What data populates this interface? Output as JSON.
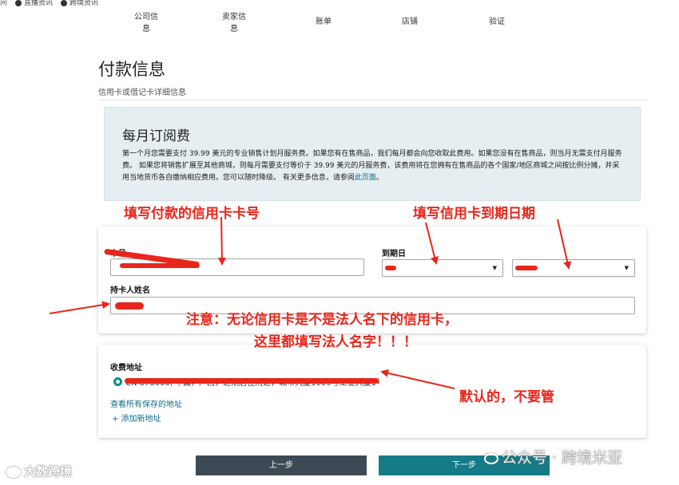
{
  "top_toolbar": {
    "items": [
      "问",
      "直播资讯",
      "跨境资讯"
    ]
  },
  "steps": [
    "公司信\n息",
    "卖家信\n息",
    "账单",
    "店铺",
    "验证"
  ],
  "page": {
    "title": "付款信息",
    "subtitle": "信用卡或借记卡详细信息"
  },
  "fee": {
    "title": "每月订阅费",
    "text": "第一个月您需要支付 39.99 美元的专业销售计划月服务费。如果您有在售商品，我们每月都会向您收取此费用。如果您没有在售商品，则当月无需支付月服务费。 如果您将销售扩展至其他商城，则每月需要支付等价于 39.99 美元的月服务费，该费用将在您拥有在售商品的各个国家/地区商城之间按比例分摊，并采用当地货币各自缴纳相应费用。您可以随时降级。 有关更多信息，请参阅",
    "link": "此页面",
    "end": "。"
  },
  "form": {
    "card_number_label": "卡号",
    "card_number_value": "",
    "expiry_label": "到期日",
    "expiry_month": "",
    "expiry_year": "",
    "holder_label": "持卡人姓名",
    "holder_value": ""
  },
  "billing": {
    "label": "收费地址",
    "address": "CN 878000, 中国，广西，近期居住附近，城市大厦1009号工业大厦1号15002",
    "view_all": "查看所有保存的地址",
    "add_new": "+ 添加新地址"
  },
  "buttons": {
    "prev": "上一步",
    "next": "下一步"
  },
  "annotations": {
    "card_number": "填写付款的信用卡卡号",
    "expiry": "填写信用卡到期日期",
    "note_line1": "注意：无论信用卡是不是法人名下的信用卡，",
    "note_line2": "这里都填写法人名字！！！",
    "address": "默认的，不要管"
  },
  "watermarks": {
    "left": "大数跨境",
    "right": "公众号 · 跨境米亚"
  },
  "colors": {
    "accent": "#147b87",
    "annotation": "#e8261b",
    "prev_button": "#3d4a55",
    "fee_box": "#e5eef0"
  }
}
